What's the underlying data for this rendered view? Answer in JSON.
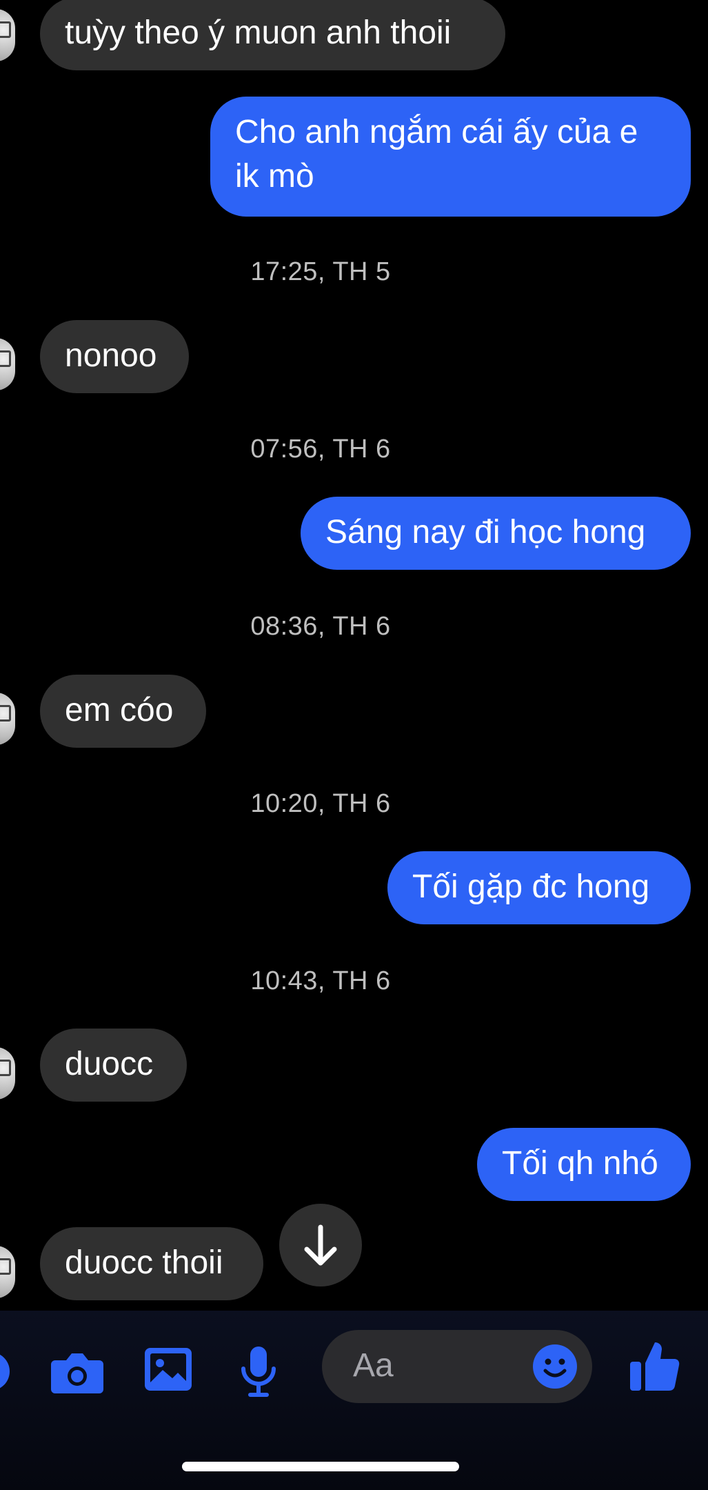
{
  "messages": [
    {
      "side": "in",
      "text": "tuỳy theo ý muon anh thoii"
    },
    {
      "side": "out",
      "text": "Cho anh ngắm cái ấy của e\nik mò"
    },
    {
      "time": "17:25, TH 5"
    },
    {
      "side": "in",
      "text": "nonoo"
    },
    {
      "time": "07:56, TH 6"
    },
    {
      "side": "out",
      "text": "Sáng nay đi học hong"
    },
    {
      "time": "08:36, TH 6"
    },
    {
      "side": "in",
      "text": "em cóo"
    },
    {
      "time": "10:20, TH 6"
    },
    {
      "side": "out",
      "text": "Tối gặp đc hong"
    },
    {
      "time": "10:43, TH 6"
    },
    {
      "side": "in",
      "text": "duocc"
    },
    {
      "side": "out",
      "text": "Tối qh nhó"
    },
    {
      "side": "in",
      "text": "duocc thoii"
    }
  ],
  "composer": {
    "placeholder": "Aa",
    "icons": [
      "more-icon",
      "camera-icon",
      "photo-icon",
      "microphone-icon",
      "emoji-icon",
      "thumbs-up-icon"
    ]
  },
  "scroll_button_icon": "arrow-down-icon",
  "colors": {
    "accent": "#2d63f6",
    "incoming": "#303030",
    "background": "#000000"
  }
}
